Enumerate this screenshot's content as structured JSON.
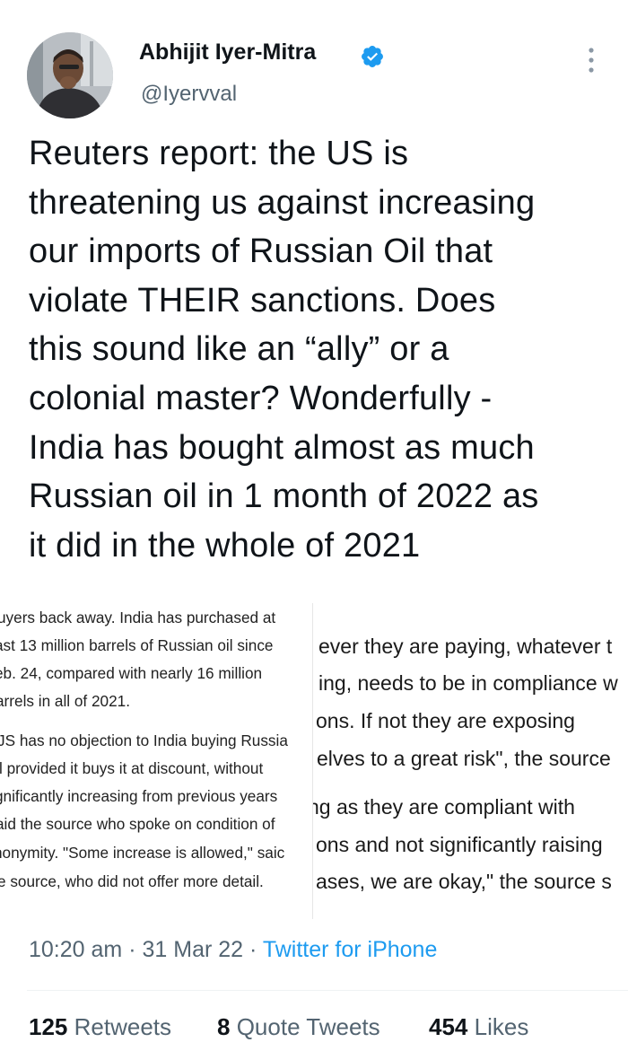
{
  "author": {
    "name": "Abhijit Iyer-Mitra",
    "handle": "@Iyervval",
    "verified": true,
    "avatar_icon": "profile-photo"
  },
  "tweet": {
    "lines": [
      "Reuters report: the US is",
      "threatening us against increasing",
      "our imports of Russian Oil that",
      "violate THEIR sanctions. Does",
      "this sound like an “ally” or a",
      "colonial master? Wonderfully -",
      "India has bought almost as much",
      "Russian oil in 1 month of 2022 as",
      "it did in the whole of 2021"
    ]
  },
  "media": {
    "left_clip": [
      "uyers back away. India has purchased at",
      "ast 13 million barrels of Russian oil since",
      "eb. 24, compared with nearly 16 million",
      "arrels in all of 2021.",
      "JS has no objection to India buying Russia",
      "l provided it buys it at discount, without",
      "gnificantly increasing from previous years",
      "aid the source who spoke on condition of",
      "nonymity. \"Some increase is allowed,\" saic",
      "e source, who did not offer more detail."
    ],
    "right_clip": [
      "ever they are paying, whatever t",
      "ing, needs to be in compliance w",
      "ons. If not they are exposing",
      "elves to a great risk\", the source",
      "ng as they are compliant with",
      "ons and not significantly raising",
      "ases, we are okay,\" the source s"
    ]
  },
  "meta": {
    "time": "10:20 am",
    "separator": "·",
    "date": "31 Mar 22",
    "source": "Twitter for iPhone"
  },
  "stats": {
    "retweets_count": "125",
    "retweets_label": "Retweets",
    "quotes_count": "8",
    "quotes_label": "Quote Tweets",
    "likes_count": "454",
    "likes_label": "Likes"
  },
  "colors": {
    "accent": "#1d9bf0",
    "secondary_text": "#536471",
    "primary_text": "#0f1419"
  }
}
